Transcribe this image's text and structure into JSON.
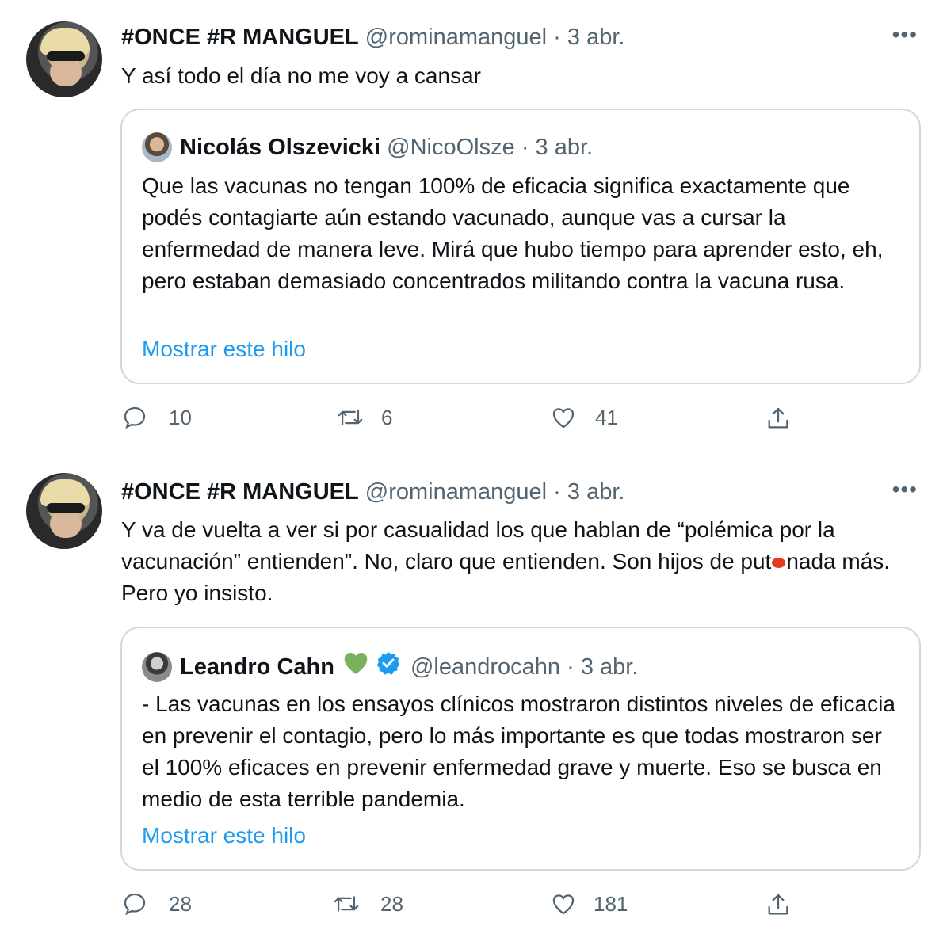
{
  "tweets": [
    {
      "author_name": "#ONCE #R MANGUEL",
      "handle": "@rominamanguel",
      "separator": "·",
      "date": "3 abr.",
      "more_label": "•••",
      "text": "Y así todo el día no me voy a cansar",
      "quote": {
        "author_name": "Nicolás Olszevicki",
        "handle": "@NicoOlsze",
        "separator": "·",
        "date": "3 abr.",
        "text": "Que las vacunas no tengan 100% de eficacia significa exactamente que podés contagiarte aún estando vacunado, aunque vas a cursar la enfermedad de manera leve. Mirá que hubo tiempo para aprender esto, eh, pero estaban demasiado concentrados militando contra la vacuna rusa.",
        "link": "Mostrar este hilo"
      },
      "stats": {
        "replies": "10",
        "retweets": "6",
        "likes": "41"
      }
    },
    {
      "author_name": "#ONCE #R MANGUEL",
      "handle": "@rominamanguel",
      "separator": "·",
      "date": "3 abr.",
      "more_label": "•••",
      "text_part1": "Y va de vuelta a ver si por casualidad los que hablan de “polémica por la vacunación” entienden”. No, claro que entienden. Son hijos de put",
      "text_part2": "nada más. Pero yo insisto.",
      "quote": {
        "author_name": "Leandro Cahn",
        "handle": "@leandrocahn",
        "separator": "·",
        "date": "3 abr.",
        "text": "- Las vacunas en los ensayos clínicos mostraron distintos niveles de eficacia en prevenir el contagio, pero lo más importante es que todas mostraron ser el 100% eficaces en prevenir enfermedad grave y muerte. Eso se busca en medio de esta terrible pandemia.",
        "link": "Mostrar este hilo"
      },
      "stats": {
        "replies": "28",
        "retweets": "28",
        "likes": "181"
      }
    }
  ],
  "colors": {
    "text": "#0f1419",
    "secondary": "#536471",
    "link": "#1d9bf0",
    "border": "#cfd9de",
    "verified": "#1d9bf0",
    "green_heart": "#78b159",
    "redaction": "#e23b1f"
  },
  "icons": [
    "reply-icon",
    "retweet-icon",
    "like-icon",
    "share-icon",
    "more-icon",
    "green-heart-icon",
    "verified-badge-icon"
  ]
}
